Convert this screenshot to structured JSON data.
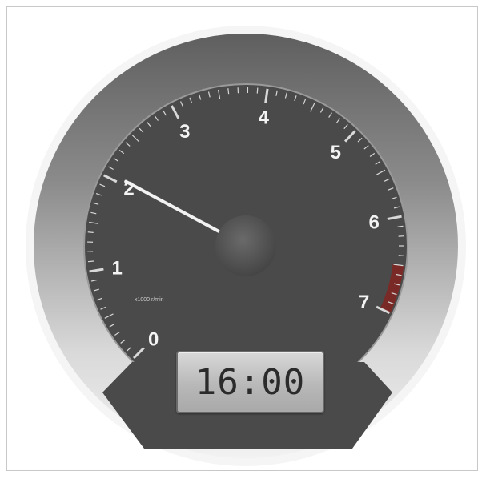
{
  "gauge": {
    "type": "tachometer",
    "scale_labels": [
      "0",
      "1",
      "2",
      "3",
      "4",
      "5",
      "6",
      "7"
    ],
    "min": 0,
    "max": 7,
    "needle_value": 2.05,
    "redline_start": 6.5,
    "small_label": "x1000 r/min",
    "colors": {
      "bezel_light": "#e6e6e6",
      "bezel_dark": "#6b6b6b",
      "face": "#4a4a4a",
      "needle": "#f2f2f2",
      "hub": "#5a5a5a",
      "redline": "#7a2a26",
      "label": "#f4f4f4"
    }
  },
  "clock": {
    "time": "16:00"
  }
}
